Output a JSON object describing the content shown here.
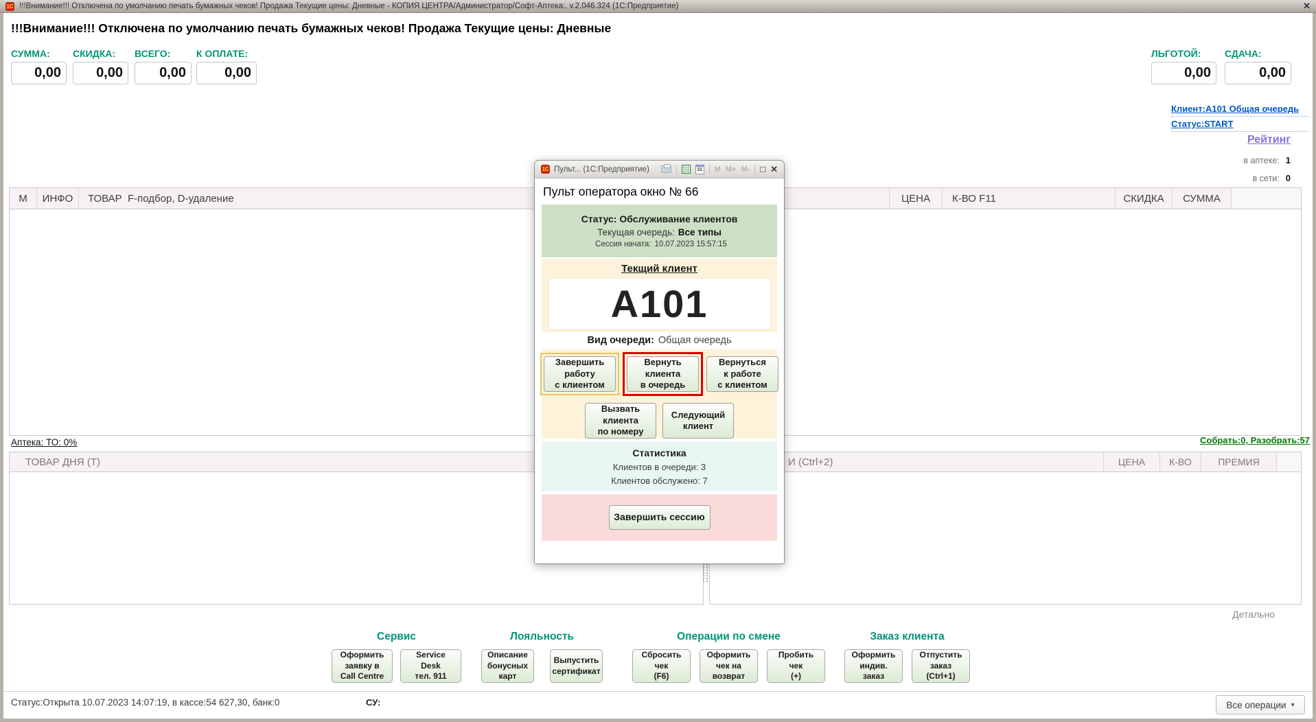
{
  "titlebar": {
    "icon": "1С",
    "title": "!!!Внимание!!! Отключена по умолчанию печать бумажных чеков! Продажа Текущие цены: Дневные - КОПИЯ ЦЕНТРА/Администратор/Софт-Аптека:, v.2.046.324  (1С:Предприятие)",
    "close": "✕"
  },
  "warning": "!!!Внимание!!! Отключена по умолчанию печать бумажных чеков! Продажа Текущие цены: Дневные",
  "totals": {
    "fields": [
      {
        "label": "СУММА:",
        "value": "0,00"
      },
      {
        "label": "СКИДКА:",
        "value": "0,00"
      },
      {
        "label": "ВСЕГО:",
        "value": "0,00"
      },
      {
        "label": "К ОПЛАТЕ:",
        "value": "0,00"
      },
      {
        "label": "ЛЬГОТОЙ:",
        "value": "0,00"
      },
      {
        "label": "СДАЧА:",
        "value": "0,00"
      }
    ]
  },
  "client_panel": {
    "client_link": "Клиент:А101 Общая очередь",
    "status_link": "Статус:START",
    "rating_link": "Рейтинг",
    "in_pharmacy_label": "в аптеке:",
    "in_pharmacy_value": "1",
    "in_network_label": "в сети:",
    "in_network_value": "0"
  },
  "main_table": {
    "col_m": "М",
    "col_info": "ИНФО",
    "col_product": "ТОВАР  F-подбор, D-удаление",
    "col_price": "ЦЕНА",
    "col_qty": "К-ВО F11",
    "col_discount": "СКИДКА",
    "col_sum": "СУММА"
  },
  "links": {
    "pharmacy": "Аптека: ТО: 0%",
    "collect": "Собрать:0, Разобрать:57",
    "details": "Детально"
  },
  "day_table": {
    "left_header": "ТОВАР ДНЯ (Т)",
    "right_header": "И (Ctrl+2)",
    "col_price": "ЦЕНА",
    "col_qty": "К-ВО",
    "col_bonus": "ПРЕМИЯ"
  },
  "dialog": {
    "titlebar_text": "Пульт...  (1С:Предприятие)",
    "icons": {
      "icon_1c": "1С",
      "calendar_day": "31",
      "memory": "M",
      "memory_plus": "M+",
      "memory_minus": "M-",
      "maximize": "□",
      "close": "✕"
    },
    "heading": "Пульт оператора окно № 66",
    "status_title": "Статус: Обслуживание клиентов",
    "queue_label": "Текущая очередь:",
    "queue_value": "Все типы",
    "session_label": "Сессия начата:",
    "session_value": "10.07.2023 15:57:15",
    "client_label": "Текщий клиент",
    "client_number": "А101",
    "queue_type_label": "Вид очереди:",
    "queue_type_value": "Общая очередь",
    "btn_finish_client": "Завершить\nработу\nс клиентом",
    "btn_return_client": "Вернуть\nклиента\nв очередь",
    "btn_back_to_work": "Вернуться\nк работе\nс клиентом",
    "btn_call_by_number": "Вызвать\nклиента\nпо номеру",
    "btn_next_client": "Следующий\nклиент",
    "stats_title": "Статистика",
    "stats_in_queue": "Клиентов в очереди: 3",
    "stats_served": "Клиентов обслужено: 7",
    "btn_end_session": "Завершить сессию"
  },
  "action_groups": [
    {
      "title": "Сервис",
      "buttons": [
        "Оформить\nзаявку в\nCall Centre",
        "Service\nDesk\nтел. 911"
      ]
    },
    {
      "title": "Лояльность",
      "buttons": [
        "Описание\nбонусных\nкарт",
        "Выпустить\nсертификат"
      ]
    },
    {
      "title": "Операции по смене",
      "buttons": [
        "Сбросить\nчек\n(F6)",
        "Оформить\nчек на\nвозврат",
        "Пробить\nчек\n(+)"
      ]
    },
    {
      "title": "Заказ клиента",
      "buttons": [
        "Оформить\nиндив.\nзаказ",
        "Отпустить\nзаказ\n(Ctrl+1)"
      ]
    }
  ],
  "statusbar": {
    "status": "Статус:Открыта 10.07.2023 14:07:19, в кассе:54 627,30, банк:0",
    "su_label": "СУ:",
    "all_operations": "Все операции",
    "dropdown_arrow": "▾"
  }
}
